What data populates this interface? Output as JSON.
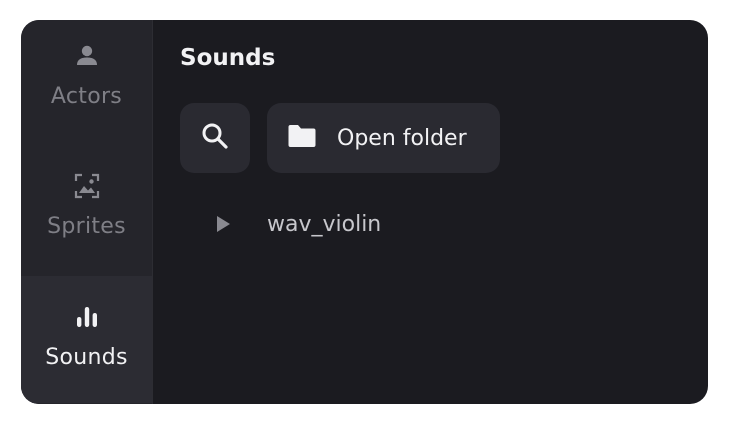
{
  "sidebar": {
    "items": [
      {
        "label": "Actors",
        "icon": "person-icon",
        "active": false
      },
      {
        "label": "Sprites",
        "icon": "image-frame-icon",
        "active": false
      },
      {
        "label": "Sounds",
        "icon": "audio-bars-icon",
        "active": true
      }
    ]
  },
  "main": {
    "title": "Sounds",
    "toolbar": {
      "search_icon": "search-icon",
      "open_folder_label": "Open folder",
      "open_folder_icon": "folder-icon"
    },
    "tree": [
      {
        "label": "wav_violin",
        "expanded": false
      }
    ]
  },
  "colors": {
    "panel_bg": "#1b1b20",
    "sidebar_bg": "#25252b",
    "active_bg": "#2c2c33",
    "button_bg": "#2a2a31",
    "text_primary": "#f2f2f4",
    "text_muted": "#7f7f86"
  }
}
